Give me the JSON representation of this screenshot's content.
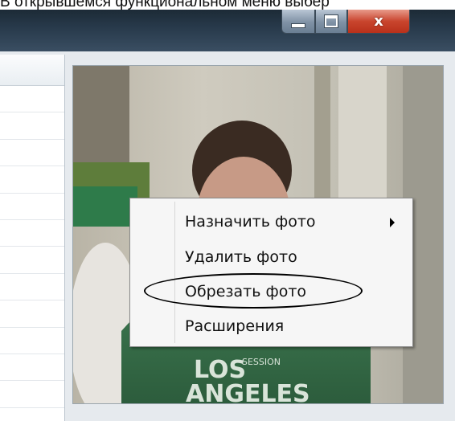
{
  "instruction": {
    "text": "В открывшемся функциональном меню выбер"
  },
  "window": {
    "minimize_icon": "minimize-icon",
    "maximize_icon": "maximize-icon",
    "close_symbol": "x"
  },
  "photo": {
    "shirt_text_line1": "LOS",
    "shirt_text_line2": "ANGELES",
    "shirt_small_text": "SESSION"
  },
  "context_menu": {
    "items": [
      {
        "label": "Назначить фото",
        "has_submenu": true
      },
      {
        "label": "Удалить фото",
        "has_submenu": false
      },
      {
        "label": "Обрезать фото",
        "has_submenu": false,
        "highlighted": true
      },
      {
        "label": "Расширения",
        "has_submenu": false
      }
    ]
  },
  "colors": {
    "titlebar": "#27394a",
    "close_button": "#c9452e",
    "menu_background": "#f6f6f6",
    "highlight_oval": "#000000"
  }
}
